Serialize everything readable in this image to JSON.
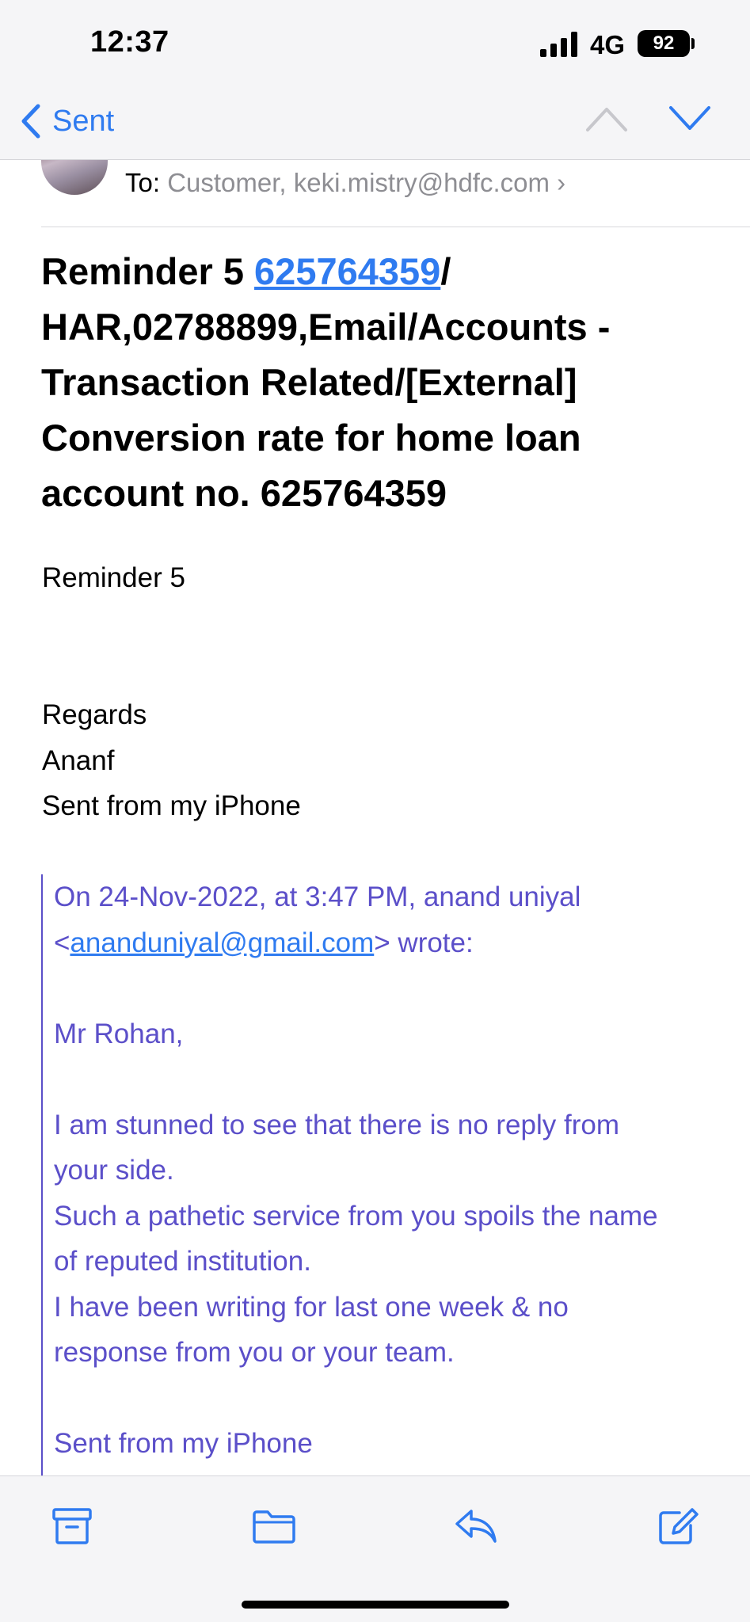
{
  "status_bar": {
    "time": "12:37",
    "network": "4G",
    "battery": "92"
  },
  "nav": {
    "back_label": "Sent",
    "prev_icon": "chevron-up-icon",
    "next_icon": "chevron-down-icon"
  },
  "header": {
    "to_label": "To:",
    "recipients": "Customer, keki.mistry@hdfc.com",
    "chevron": "›"
  },
  "subject": {
    "prefix": "Reminder 5 ",
    "link": "625764359",
    "suffix": "/ HAR,02788899,Email/Accounts - Transaction Related/[External] Conversion rate for home loan account no. 625764359"
  },
  "body": {
    "line1": "Reminder 5",
    "regards": "Regards",
    "name": "Ananf",
    "signature": "Sent from my iPhone"
  },
  "quote": {
    "intro": "On 24-Nov-2022, at 3:47 PM, anand uniyal",
    "email_open": "<",
    "email": "ananduniyal@gmail.com",
    "email_close": "> wrote:",
    "greeting": "Mr Rohan,",
    "p1a": "I am stunned to see that there is no reply from",
    "p1b": "your side.",
    "p2a": "Such a pathetic service from you spoils the name",
    "p2b": "of reputed institution.",
    "p3a": "I have been writing for last one week & no",
    "p3b": "response from you or your team.",
    "signature": "Sent from my iPhone"
  },
  "toolbar": {
    "archive_icon": "archive-icon",
    "folder_icon": "folder-icon",
    "reply_icon": "reply-icon",
    "compose_icon": "compose-icon"
  },
  "colors": {
    "accent": "#2f7bf0",
    "quote": "#5b4fc9",
    "secondary_text": "#8e8e93",
    "bar_background": "#f5f5f7"
  }
}
